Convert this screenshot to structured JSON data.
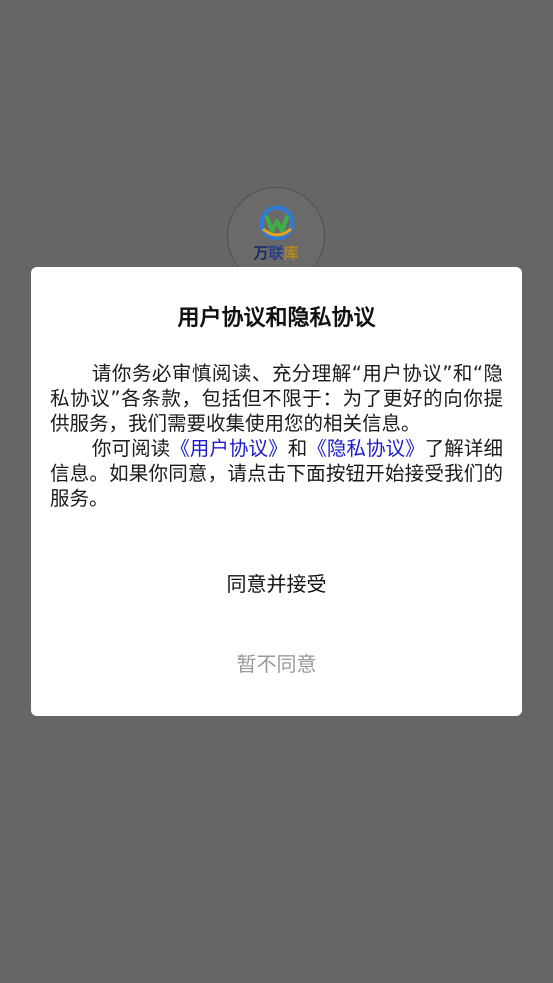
{
  "app": {
    "logo_text_part1": "万",
    "logo_text_part2": "联",
    "logo_text_part3": "库"
  },
  "dialog": {
    "title": "用户协议和隐私协议",
    "paragraph1": "请你务必审慎阅读、充分理解“用户协议”和“隐私协议”各条款，包括但不限于：为了更好的向你提供服务，我们需要收集使用您的相关信息。",
    "paragraph2_prefix": "你可阅读",
    "user_agreement_link": "《用户协议》",
    "paragraph2_and": "和",
    "privacy_agreement_link": "《隐私协议》",
    "paragraph2_suffix": "了解详细信息。如果你同意，请点击下面按钮开始接受我们的服务。",
    "agree_label": "同意并接受",
    "disagree_label": "暂不同意"
  },
  "colors": {
    "overlay": "#666666",
    "dialog_background": "#ffffff",
    "link": "#1a1acc",
    "disabled_text": "#9a9a9a"
  }
}
